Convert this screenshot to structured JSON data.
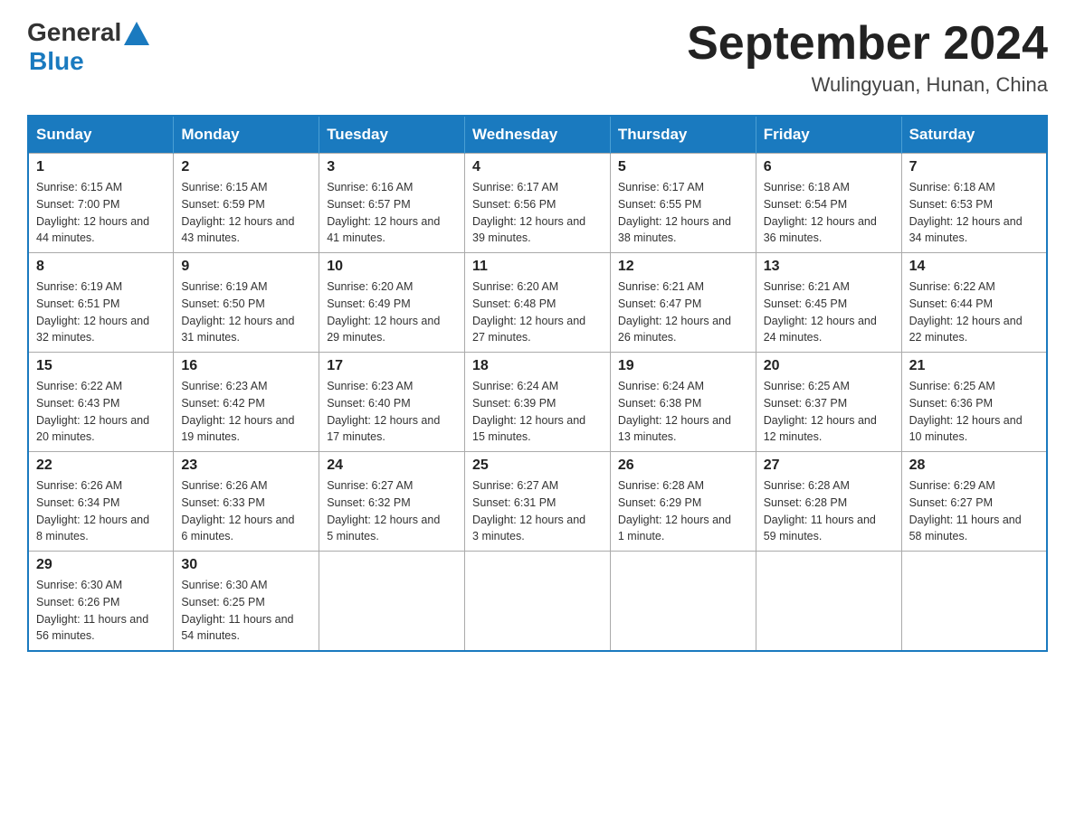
{
  "logo": {
    "general": "General",
    "arrow": "▶",
    "blue": "Blue"
  },
  "title": "September 2024",
  "subtitle": "Wulingyuan, Hunan, China",
  "weekdays": [
    "Sunday",
    "Monday",
    "Tuesday",
    "Wednesday",
    "Thursday",
    "Friday",
    "Saturday"
  ],
  "weeks": [
    [
      {
        "day": "1",
        "sunrise": "Sunrise: 6:15 AM",
        "sunset": "Sunset: 7:00 PM",
        "daylight": "Daylight: 12 hours and 44 minutes."
      },
      {
        "day": "2",
        "sunrise": "Sunrise: 6:15 AM",
        "sunset": "Sunset: 6:59 PM",
        "daylight": "Daylight: 12 hours and 43 minutes."
      },
      {
        "day": "3",
        "sunrise": "Sunrise: 6:16 AM",
        "sunset": "Sunset: 6:57 PM",
        "daylight": "Daylight: 12 hours and 41 minutes."
      },
      {
        "day": "4",
        "sunrise": "Sunrise: 6:17 AM",
        "sunset": "Sunset: 6:56 PM",
        "daylight": "Daylight: 12 hours and 39 minutes."
      },
      {
        "day": "5",
        "sunrise": "Sunrise: 6:17 AM",
        "sunset": "Sunset: 6:55 PM",
        "daylight": "Daylight: 12 hours and 38 minutes."
      },
      {
        "day": "6",
        "sunrise": "Sunrise: 6:18 AM",
        "sunset": "Sunset: 6:54 PM",
        "daylight": "Daylight: 12 hours and 36 minutes."
      },
      {
        "day": "7",
        "sunrise": "Sunrise: 6:18 AM",
        "sunset": "Sunset: 6:53 PM",
        "daylight": "Daylight: 12 hours and 34 minutes."
      }
    ],
    [
      {
        "day": "8",
        "sunrise": "Sunrise: 6:19 AM",
        "sunset": "Sunset: 6:51 PM",
        "daylight": "Daylight: 12 hours and 32 minutes."
      },
      {
        "day": "9",
        "sunrise": "Sunrise: 6:19 AM",
        "sunset": "Sunset: 6:50 PM",
        "daylight": "Daylight: 12 hours and 31 minutes."
      },
      {
        "day": "10",
        "sunrise": "Sunrise: 6:20 AM",
        "sunset": "Sunset: 6:49 PM",
        "daylight": "Daylight: 12 hours and 29 minutes."
      },
      {
        "day": "11",
        "sunrise": "Sunrise: 6:20 AM",
        "sunset": "Sunset: 6:48 PM",
        "daylight": "Daylight: 12 hours and 27 minutes."
      },
      {
        "day": "12",
        "sunrise": "Sunrise: 6:21 AM",
        "sunset": "Sunset: 6:47 PM",
        "daylight": "Daylight: 12 hours and 26 minutes."
      },
      {
        "day": "13",
        "sunrise": "Sunrise: 6:21 AM",
        "sunset": "Sunset: 6:45 PM",
        "daylight": "Daylight: 12 hours and 24 minutes."
      },
      {
        "day": "14",
        "sunrise": "Sunrise: 6:22 AM",
        "sunset": "Sunset: 6:44 PM",
        "daylight": "Daylight: 12 hours and 22 minutes."
      }
    ],
    [
      {
        "day": "15",
        "sunrise": "Sunrise: 6:22 AM",
        "sunset": "Sunset: 6:43 PM",
        "daylight": "Daylight: 12 hours and 20 minutes."
      },
      {
        "day": "16",
        "sunrise": "Sunrise: 6:23 AM",
        "sunset": "Sunset: 6:42 PM",
        "daylight": "Daylight: 12 hours and 19 minutes."
      },
      {
        "day": "17",
        "sunrise": "Sunrise: 6:23 AM",
        "sunset": "Sunset: 6:40 PM",
        "daylight": "Daylight: 12 hours and 17 minutes."
      },
      {
        "day": "18",
        "sunrise": "Sunrise: 6:24 AM",
        "sunset": "Sunset: 6:39 PM",
        "daylight": "Daylight: 12 hours and 15 minutes."
      },
      {
        "day": "19",
        "sunrise": "Sunrise: 6:24 AM",
        "sunset": "Sunset: 6:38 PM",
        "daylight": "Daylight: 12 hours and 13 minutes."
      },
      {
        "day": "20",
        "sunrise": "Sunrise: 6:25 AM",
        "sunset": "Sunset: 6:37 PM",
        "daylight": "Daylight: 12 hours and 12 minutes."
      },
      {
        "day": "21",
        "sunrise": "Sunrise: 6:25 AM",
        "sunset": "Sunset: 6:36 PM",
        "daylight": "Daylight: 12 hours and 10 minutes."
      }
    ],
    [
      {
        "day": "22",
        "sunrise": "Sunrise: 6:26 AM",
        "sunset": "Sunset: 6:34 PM",
        "daylight": "Daylight: 12 hours and 8 minutes."
      },
      {
        "day": "23",
        "sunrise": "Sunrise: 6:26 AM",
        "sunset": "Sunset: 6:33 PM",
        "daylight": "Daylight: 12 hours and 6 minutes."
      },
      {
        "day": "24",
        "sunrise": "Sunrise: 6:27 AM",
        "sunset": "Sunset: 6:32 PM",
        "daylight": "Daylight: 12 hours and 5 minutes."
      },
      {
        "day": "25",
        "sunrise": "Sunrise: 6:27 AM",
        "sunset": "Sunset: 6:31 PM",
        "daylight": "Daylight: 12 hours and 3 minutes."
      },
      {
        "day": "26",
        "sunrise": "Sunrise: 6:28 AM",
        "sunset": "Sunset: 6:29 PM",
        "daylight": "Daylight: 12 hours and 1 minute."
      },
      {
        "day": "27",
        "sunrise": "Sunrise: 6:28 AM",
        "sunset": "Sunset: 6:28 PM",
        "daylight": "Daylight: 11 hours and 59 minutes."
      },
      {
        "day": "28",
        "sunrise": "Sunrise: 6:29 AM",
        "sunset": "Sunset: 6:27 PM",
        "daylight": "Daylight: 11 hours and 58 minutes."
      }
    ],
    [
      {
        "day": "29",
        "sunrise": "Sunrise: 6:30 AM",
        "sunset": "Sunset: 6:26 PM",
        "daylight": "Daylight: 11 hours and 56 minutes."
      },
      {
        "day": "30",
        "sunrise": "Sunrise: 6:30 AM",
        "sunset": "Sunset: 6:25 PM",
        "daylight": "Daylight: 11 hours and 54 minutes."
      },
      null,
      null,
      null,
      null,
      null
    ]
  ]
}
